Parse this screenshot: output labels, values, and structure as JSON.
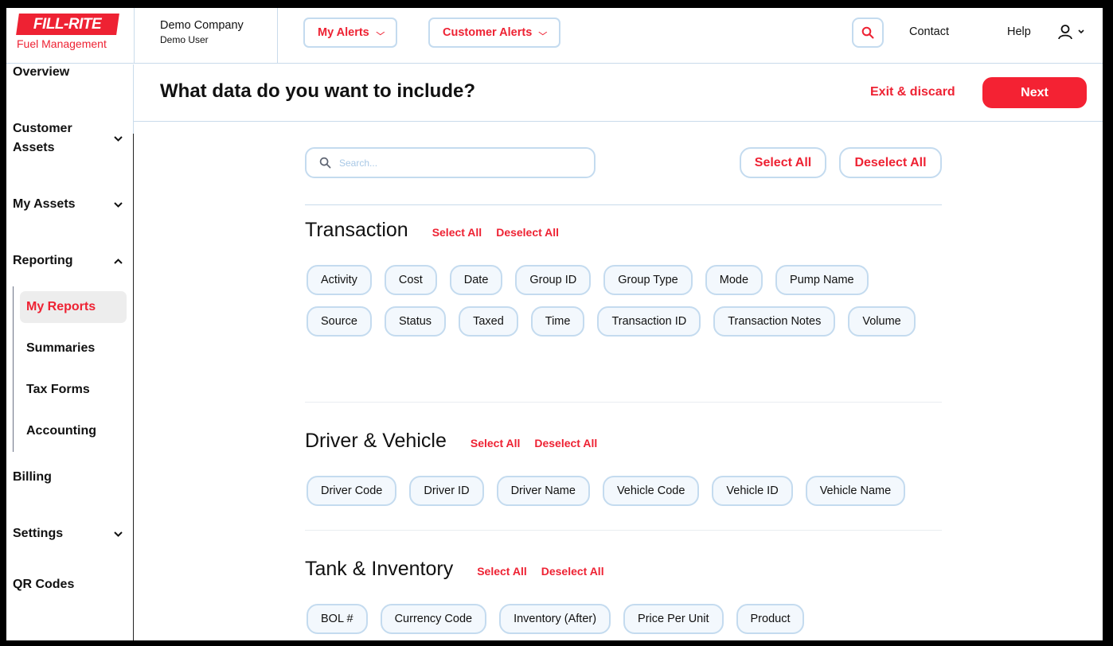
{
  "brand": {
    "logo_text": "FILL-RITE",
    "logo_subtitle": "Fuel Management",
    "accent_color": "#ee2233"
  },
  "account": {
    "company": "Demo Company",
    "user": "Demo User"
  },
  "header": {
    "alerts": [
      {
        "label": "My Alerts"
      },
      {
        "label": "Customer Alerts"
      }
    ],
    "search_icon": "search-icon",
    "links": [
      {
        "label": "Contact"
      },
      {
        "label": "Help"
      }
    ],
    "user_icon": "user-icon"
  },
  "sidebar": {
    "items": [
      {
        "label": "Overview",
        "expandable": false
      },
      {
        "label": "Customer Assets",
        "expandable": true,
        "expanded": false
      },
      {
        "label": "My Assets",
        "expandable": true,
        "expanded": false
      },
      {
        "label": "Reporting",
        "expandable": true,
        "expanded": true
      },
      {
        "label": "Billing",
        "expandable": false
      },
      {
        "label": "Settings",
        "expandable": true,
        "expanded": false
      },
      {
        "label": "QR Codes",
        "expandable": false
      }
    ],
    "reporting_sub": [
      {
        "label": "My Reports",
        "active": true
      },
      {
        "label": "Summaries",
        "active": false
      },
      {
        "label": "Tax Forms",
        "active": false
      },
      {
        "label": "Accounting",
        "active": false
      }
    ]
  },
  "page": {
    "title": "What data do you want to include?",
    "exit_label": "Exit & discard",
    "next_label": "Next"
  },
  "search": {
    "placeholder": "Search...",
    "value": ""
  },
  "global_actions": {
    "select_all": "Select All",
    "deselect_all": "Deselect All"
  },
  "sections": [
    {
      "title": "Transaction",
      "select_all": "Select All",
      "deselect_all": "Deselect All",
      "fields": [
        "Activity",
        "Cost",
        "Date",
        "Group ID",
        "Group Type",
        "Mode",
        "Pump Name",
        "Source",
        "Status",
        "Taxed",
        "Time",
        "Transaction ID",
        "Transaction Notes",
        "Volume"
      ]
    },
    {
      "title": "Driver & Vehicle",
      "select_all": "Select All",
      "deselect_all": "Deselect All",
      "fields": [
        "Driver Code",
        "Driver ID",
        "Driver Name",
        "Vehicle Code",
        "Vehicle ID",
        "Vehicle Name"
      ]
    },
    {
      "title": "Tank & Inventory",
      "select_all": "Select All",
      "deselect_all": "Deselect All",
      "fields": [
        "BOL #",
        "Currency Code",
        "Inventory (After)",
        "Price Per Unit",
        "Product"
      ]
    }
  ]
}
